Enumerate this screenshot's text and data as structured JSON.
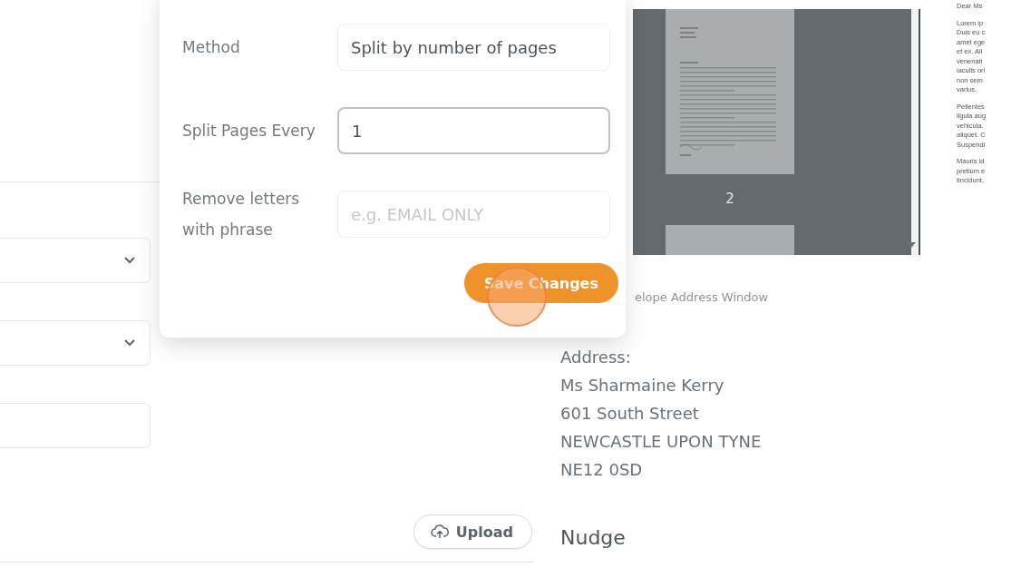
{
  "left_form": {
    "fields": [
      {
        "kind": "select"
      },
      {
        "kind": "select"
      },
      {
        "kind": "input"
      }
    ]
  },
  "upload_button": "Upload",
  "modal": {
    "fields": [
      {
        "label": "Method",
        "value": "Split by number of pages",
        "focused": false
      },
      {
        "label": "Split Pages Every",
        "value": "1",
        "focused": true
      },
      {
        "label": "Remove letters with phrase",
        "placeholder": "e.g. EMAIL ONLY",
        "focused": false
      }
    ],
    "save_button": "Save Changes"
  },
  "preview": {
    "page_number": "2"
  },
  "envelope_label": "elope Address Window",
  "address": {
    "heading": "Address:",
    "lines": [
      "Ms Sharmaine Kerry",
      "601 South Street",
      "NEWCASTLE UPON TYNE",
      "NE12 0SD"
    ]
  },
  "nudge_heading": "Nudge",
  "letter": {
    "paragraphs": [
      [
        "Dear Ms"
      ],
      [
        "Lorem ip",
        "Duis eu c",
        "amet ege",
        "et ex. Ali",
        "venenati",
        "iaculis ori",
        "non sem",
        "varius."
      ],
      [
        "Pellentes",
        "ligula aug",
        "vehicula.",
        "aliquet. C",
        "Suspendi"
      ],
      [
        "Mauris id",
        "pretium e",
        "tincidunt,"
      ]
    ]
  }
}
